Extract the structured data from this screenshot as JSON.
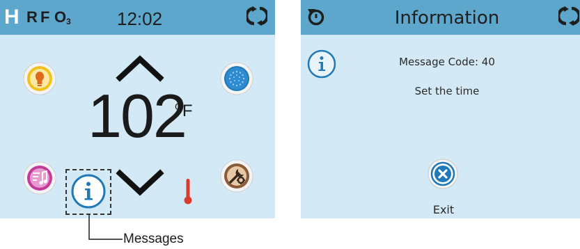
{
  "main_screen": {
    "status": {
      "heater_indicator": "H",
      "indicator_r": "R",
      "indicator_f": "F",
      "ozone_letter": "O",
      "ozone_subscript": "3",
      "time": "12:02"
    },
    "temperature": {
      "value": "102",
      "degree_symbol": "O",
      "unit": "F"
    },
    "icons": {
      "light": "light-bulb-icon",
      "jets": "jets-icon",
      "music": "music-icon",
      "settings": "settings-icon",
      "messages": "info-icon",
      "thermometer": "thermometer-icon",
      "sync": "sync-icon"
    },
    "callout_label": "Messages"
  },
  "info_screen": {
    "title": "Information",
    "message_code": "Message Code: 40",
    "message_text": "Set the time",
    "exit_label": "Exit"
  },
  "colors": {
    "screen_background": "#d3e9f5",
    "status_bar": "#5da7cd",
    "icon_blue": "#1f78b8",
    "light_yellow": "#f2c21a",
    "music_purple": "#c33c9c",
    "settings_brown": "#8a5a36",
    "thermometer_red": "#d93a2c"
  }
}
